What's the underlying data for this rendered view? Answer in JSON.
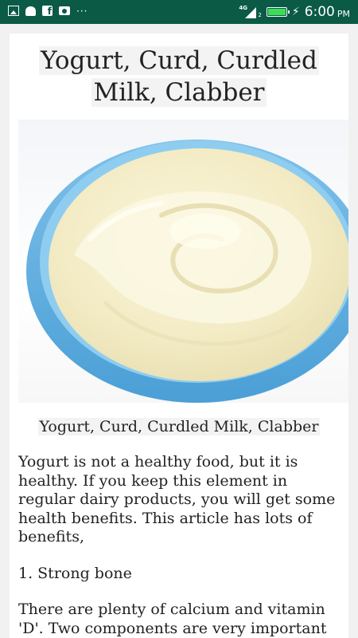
{
  "status_bar": {
    "left_icons": [
      "image-icon",
      "android-icon",
      "facebook-icon",
      "camera-icon",
      "more-notifications-icon"
    ],
    "more_glyph": "···",
    "network_label": "4G",
    "sim_index": "2",
    "time": "6:00",
    "ampm": "PM",
    "battery_color": "#3ddc57",
    "bar_color": "#0a5a46"
  },
  "article": {
    "title": "Yogurt, Curd, Curdled Milk, Clabber",
    "image_caption": "Yogurt, Curd, Curdled Milk, Clabber",
    "paragraphs": [
      "Yogurt is not a healthy food, but it is healthy. If you keep this element in regular dairy products, you will get some health benefits. This article has lots of benefits,",
      "1. Strong bone",
      "There are plenty of calcium and vitamin 'D'. Two components are very important"
    ]
  }
}
